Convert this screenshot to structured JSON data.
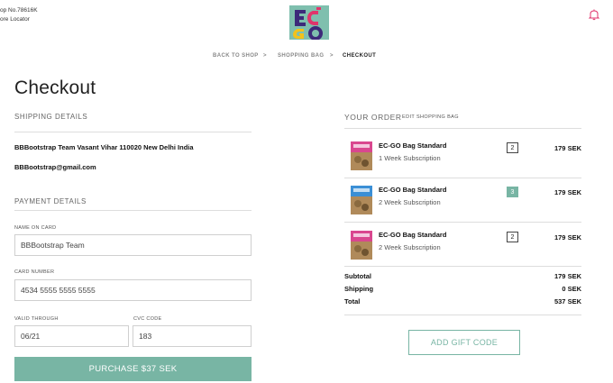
{
  "header": {
    "store_line1": "op No.78616K",
    "store_line2": "ore Locator"
  },
  "breadcrumb": {
    "back": "BACK TO SHOP",
    "sep1": ">",
    "bag": "SHOPPING BAG",
    "sep2": ">",
    "current": "CHECKOUT"
  },
  "page_title": "Checkout",
  "shipping": {
    "label": "SHIPPING DETAILS",
    "address": "BBBootstrap Team Vasant Vihar 110020 New Delhi India",
    "email": "BBBootstrap@gmail.com"
  },
  "payment": {
    "label": "PAYMENT DETAILS",
    "name_label": "NAME ON CARD",
    "name_value": "BBBootstrap Team",
    "card_label": "CARD NUMBER",
    "card_value": "4534 5555 5555 5555",
    "valid_label": "VALID THROUGH",
    "valid_value": "06/21",
    "cvc_label": "CVC CODE",
    "cvc_value": "183",
    "purchase_label": "PURCHASE $37 SEK"
  },
  "order": {
    "label": "YOUR ORDER",
    "edit_label": "EDIT SHOPPING BAG",
    "items": [
      {
        "name": "EC-GO Bag Standard",
        "sub": "1 Week Subscription",
        "qty": "2",
        "price": "179 SEK",
        "thumb_color": "#d9478f",
        "qty_active": false
      },
      {
        "name": "EC-GO Bag Standard",
        "sub": "2 Week Subscription",
        "qty": "3",
        "price": "179 SEK",
        "thumb_color": "#3b8fd6",
        "qty_active": true
      },
      {
        "name": "EC-GO Bag Standard",
        "sub": "2 Week Subscription",
        "qty": "2",
        "price": "179 SEK",
        "thumb_color": "#d9478f",
        "qty_active": false
      }
    ],
    "subtotal_label": "Subtotal",
    "subtotal_value": "179 SEK",
    "shipping_label": "Shipping",
    "shipping_value": "0 SEK",
    "total_label": "Total",
    "total_value": "537 SEK",
    "gift_label": "ADD GIFT CODE"
  },
  "colors": {
    "accent": "#78b5a4",
    "logo_bg": "#7fbfae"
  },
  "icons": {
    "bell": "bell-icon",
    "logo": "ecgo-logo"
  }
}
